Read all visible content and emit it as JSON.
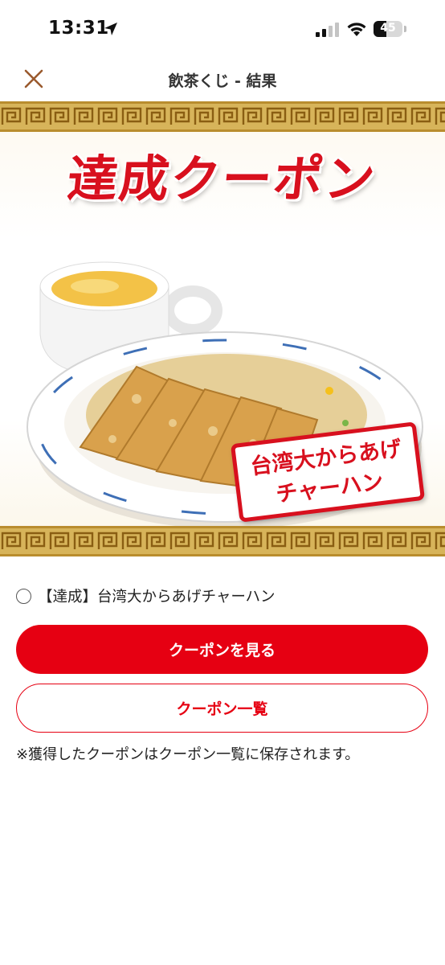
{
  "status_bar": {
    "time": "13:31",
    "battery_level": "45",
    "battery_fraction": 0.45,
    "icons": [
      "location-arrow-icon",
      "cellular-signal-icon",
      "wifi-icon",
      "battery-icon"
    ]
  },
  "header": {
    "title": "飲茶くじ - 結果",
    "close_icon": "close-icon"
  },
  "banner": {
    "title": "達成クーポン",
    "stamp_line1": "台湾大からあげ",
    "stamp_line2": "チャーハン"
  },
  "coupon": {
    "label": "【達成】台湾大からあげチャーハン",
    "selected": false
  },
  "actions": {
    "view_coupon": "クーポンを見る",
    "coupon_list": "クーポン一覧"
  },
  "note": "※獲得したクーポンはクーポン一覧に保存されます。",
  "colors": {
    "accent": "#e60012",
    "banner_title": "#d8101e",
    "fret_gold": "#d7b45a"
  }
}
